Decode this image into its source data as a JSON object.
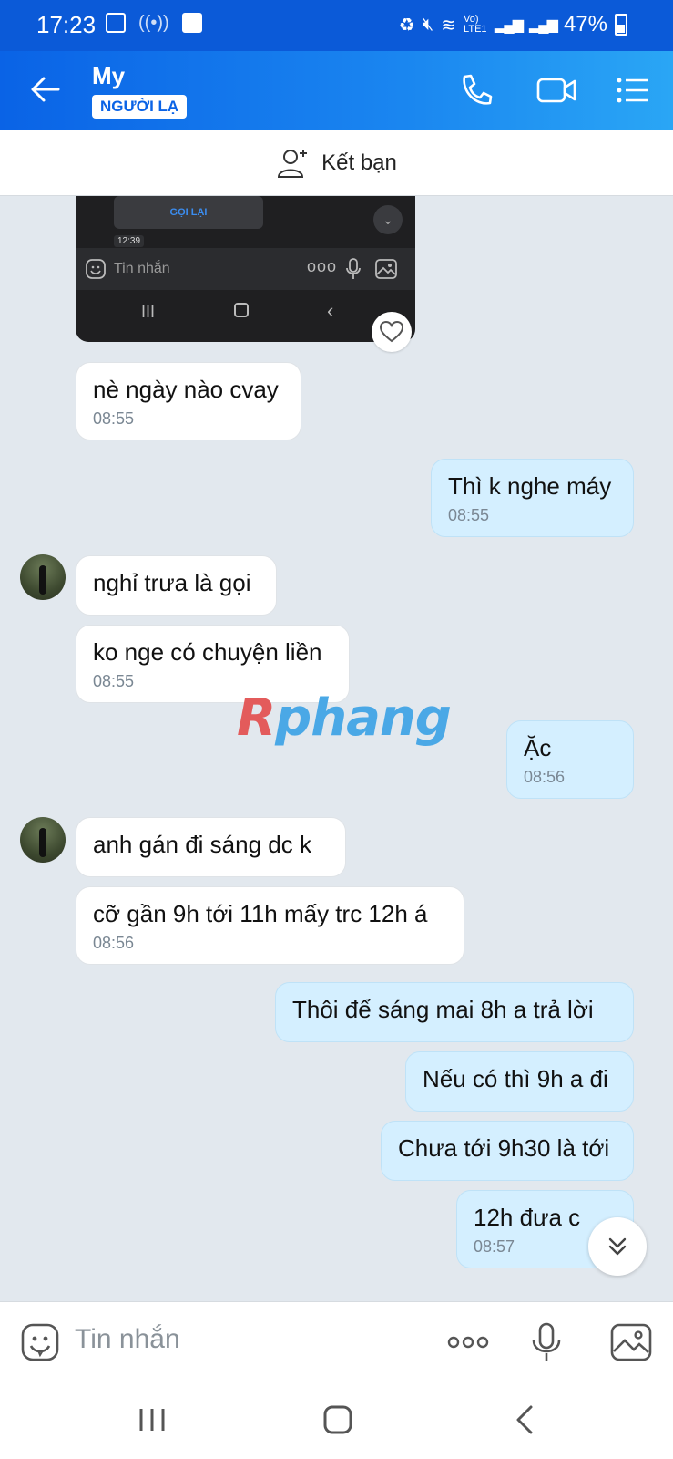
{
  "status_bar": {
    "time": "17:23",
    "network": "Vo) LTE1",
    "battery": "47%"
  },
  "header": {
    "contact_name": "My",
    "stranger_badge": "NGƯỜI LẠ"
  },
  "friend_bar": {
    "label": "Kết bạn"
  },
  "shared_screenshot": {
    "call_button": "GỌI LẠI",
    "time": "12:39",
    "input_placeholder": "Tin nhắn"
  },
  "messages": [
    {
      "dir": "in",
      "text": "nè ngày nào cvay",
      "time": "08:55"
    },
    {
      "dir": "out",
      "text": "Thì k nghe máy",
      "time": "08:55"
    },
    {
      "dir": "in",
      "text": "nghỉ trưa là gọi",
      "time": ""
    },
    {
      "dir": "in",
      "text": "ko nge có chuyện liền",
      "time": "08:55"
    },
    {
      "dir": "out",
      "text": "Ặc",
      "time": "08:56"
    },
    {
      "dir": "in",
      "text": "anh gán đi sáng dc k",
      "time": ""
    },
    {
      "dir": "in",
      "text": "cỡ gần 9h tới 11h mấy trc 12h á",
      "time": "08:56"
    },
    {
      "dir": "out",
      "text": "Thôi để sáng mai 8h a trả lời",
      "time": ""
    },
    {
      "dir": "out",
      "text": "Nếu có thì 9h a đi",
      "time": ""
    },
    {
      "dir": "out",
      "text": "Chưa tới 9h30 là tới",
      "time": ""
    },
    {
      "dir": "out",
      "text": "12h đưa c",
      "time": "08:57"
    }
  ],
  "watermark": {
    "first": "R",
    "rest": "phang"
  },
  "input": {
    "placeholder": "Tin nhắn"
  },
  "colors": {
    "header_blue": "#0a63e6",
    "incoming_bubble": "#ffffff",
    "outgoing_bubble": "#d4efff",
    "chat_background": "#e2e8ee"
  }
}
